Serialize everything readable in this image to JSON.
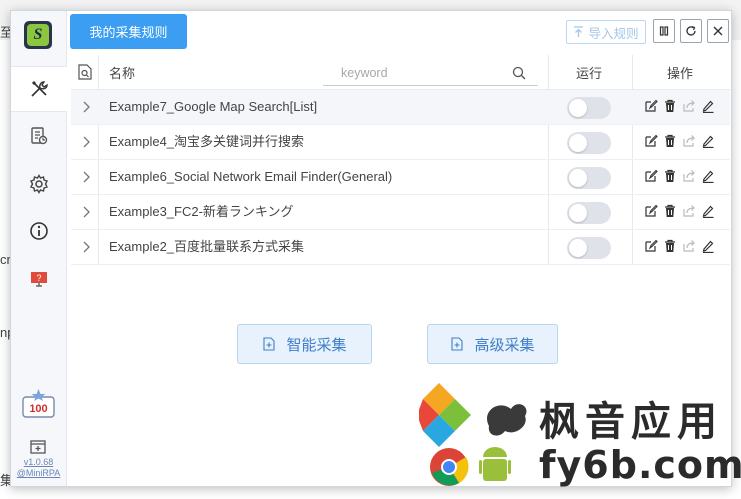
{
  "background": {
    "left_fragments": [
      "至",
      "cri",
      "np",
      "集"
    ]
  },
  "sidebar": {
    "logo_letter": "S",
    "items": [
      {
        "name": "tools",
        "icon": "tools-icon"
      },
      {
        "name": "tasks",
        "icon": "data-list-icon"
      },
      {
        "name": "settings",
        "icon": "gear-icon"
      },
      {
        "name": "about",
        "icon": "info-icon"
      },
      {
        "name": "support",
        "icon": "monitor-help-icon"
      }
    ],
    "badge_value": "100",
    "version": "v1.0.68",
    "brand": "@MiniRPA"
  },
  "header": {
    "tab_label": "我的采集规则",
    "import_label": "导入规则"
  },
  "table": {
    "columns": {
      "name": "名称",
      "run": "运行",
      "ops": "操作"
    },
    "search_placeholder": "keyword",
    "rows": [
      {
        "name": "Example7_Google Map Search[List]",
        "running": false
      },
      {
        "name": "Example4_淘宝多关键词并行搜索",
        "running": false
      },
      {
        "name": "Example6_Social Network Email Finder(General)",
        "running": false
      },
      {
        "name": "Example3_FC2-新着ランキング",
        "running": false
      },
      {
        "name": "Example2_百度批量联系方式采集",
        "running": false
      }
    ]
  },
  "actions": {
    "smart_label": "智能采集",
    "advanced_label": "高级采集"
  },
  "watermark": {
    "line1": "枫音应用",
    "line2": "fy6b.com"
  },
  "colors": {
    "accent": "#3b9ef2",
    "button_text": "#3f7ec9"
  }
}
